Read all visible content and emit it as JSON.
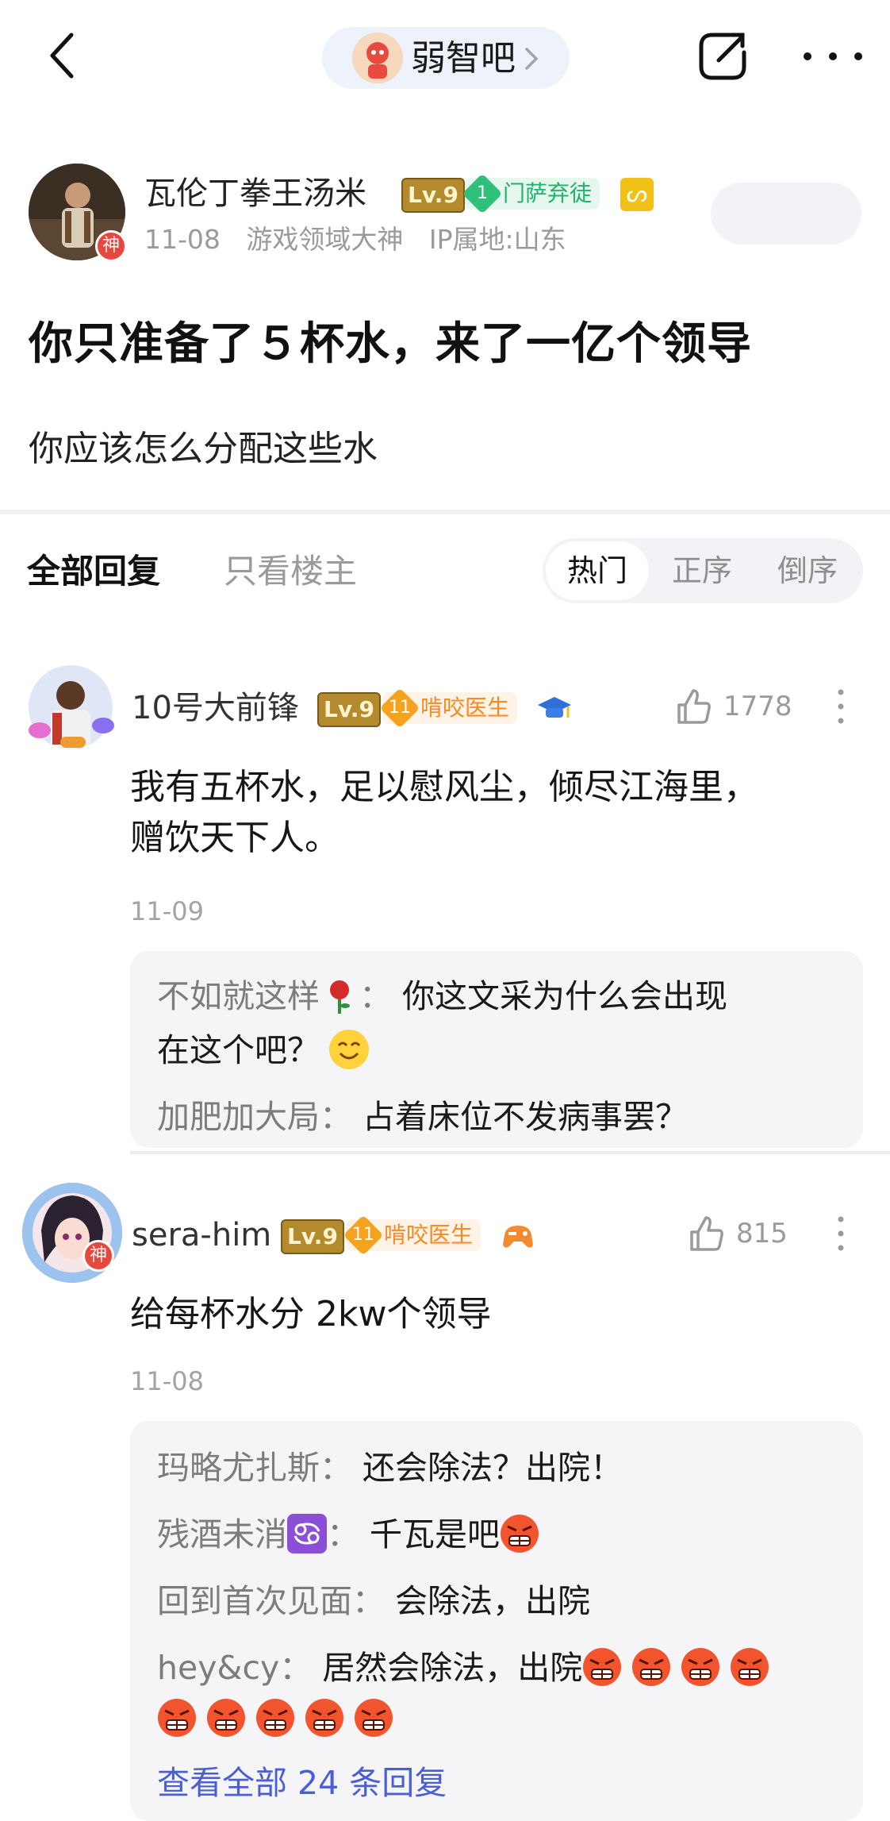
{
  "topbar": {
    "forum_name": "弱智吧"
  },
  "post": {
    "author": "瓦伦丁拳王汤米",
    "level": "Lv.9",
    "fan_level": "1",
    "title_badge": "门萨弃徒",
    "god_badge": "神",
    "sign_icon": "ᔕ",
    "meta": [
      "11-08",
      "游戏领域大神",
      "IP属地:山东"
    ],
    "title": "你只准备了５杯水，来了一亿个领导",
    "body": "你应该怎么分配这些水"
  },
  "tabs": {
    "all": "全部回复",
    "op_only": "只看楼主",
    "sort": [
      "热门",
      "正序",
      "倒序"
    ]
  },
  "comments": [
    {
      "name": "10号大前锋",
      "level": "Lv.9",
      "fan_level": "11",
      "badge": "啃咬医生",
      "likes": "1778",
      "text_lines": [
        "我有五杯水，足以慰风尘，倾尽江海里，",
        "赠饮天下人。"
      ],
      "date": "11-09",
      "replies": [
        {
          "name": "不如就这样",
          "sep": "：",
          "text": "你这文采为什么会出现"
        },
        {
          "name": "",
          "sep": "",
          "text": "在这个吧？"
        },
        {
          "name": "加肥加大局",
          "sep": "：",
          "text": "占着床位不发病事罢？"
        }
      ]
    },
    {
      "name": "sera-him",
      "level": "Lv.9",
      "fan_level": "11",
      "badge": "啃咬医生",
      "god_badge": "神",
      "likes": "815",
      "text": "给每杯水分 2kw个领导",
      "date": "11-08",
      "replies": [
        {
          "name": "玛略尤扎斯",
          "sep": "：",
          "text": "还会除法？出院！"
        },
        {
          "name": "残酒未消",
          "sep": "：",
          "text": "千瓦是吧"
        },
        {
          "name": "回到首次见面",
          "sep": "：",
          "text": "会除法，出院"
        },
        {
          "name": "hey&cy",
          "sep": "：",
          "text": "居然会除法，出院"
        }
      ],
      "view_all": "查看全部 24 条回复"
    }
  ],
  "colors": {
    "accent_blue": "#4a5fd6",
    "green_badge": "#1fb36b",
    "orange_badge": "#f58a1f",
    "level_gold": "#b38a2e"
  }
}
